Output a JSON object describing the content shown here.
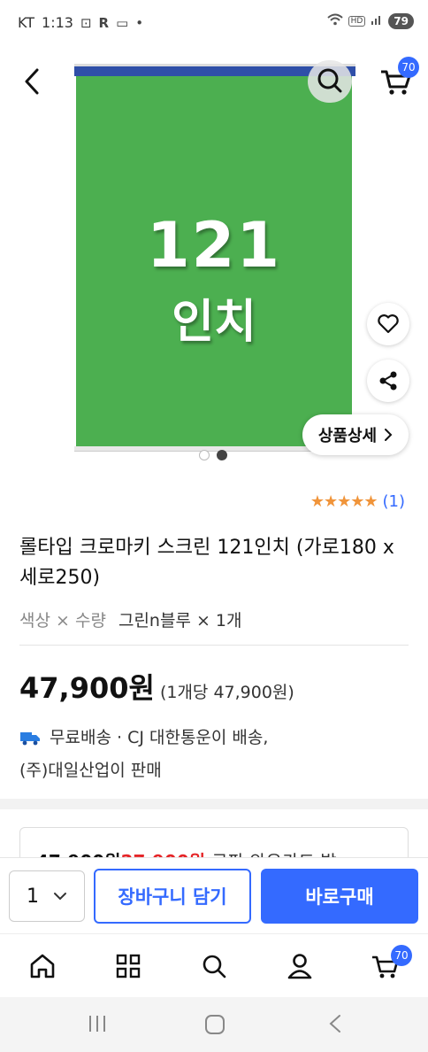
{
  "status_bar": {
    "carrier": "KT",
    "time": "1:13",
    "battery": "79"
  },
  "header": {
    "cart_count": "70"
  },
  "hero": {
    "number": "121",
    "unit": "인치",
    "green": "#4caf50",
    "roller_color": "#2f4fa8"
  },
  "detail_button": {
    "label": "상품상세"
  },
  "rating": {
    "stars": "★★★★★",
    "count": "(1)"
  },
  "product": {
    "title": "롤타입 크로마키 스크린 121인치 (가로180 x 세로250)",
    "option_label": "색상 × 수량",
    "option_value": "그린n블루 × 1개",
    "price": "47,900원",
    "unit_price": "(1개당 47,900원)",
    "shipping_line1": "무료배송 · CJ 대한통운이 배송,",
    "shipping_line2": "(주)대일산업이 판매"
  },
  "coupon": {
    "original": "47,900원",
    "sale": "27,900원",
    "desc": "쿠팡 와우카드 발"
  },
  "buy_bar": {
    "quantity": "1",
    "add_to_cart": "장바구니 담기",
    "buy_now": "바로구매"
  },
  "tab_nav": {
    "cart_count": "70"
  },
  "colors": {
    "accent": "#346aff",
    "sale_red": "#e52528",
    "star": "#f0943a"
  }
}
